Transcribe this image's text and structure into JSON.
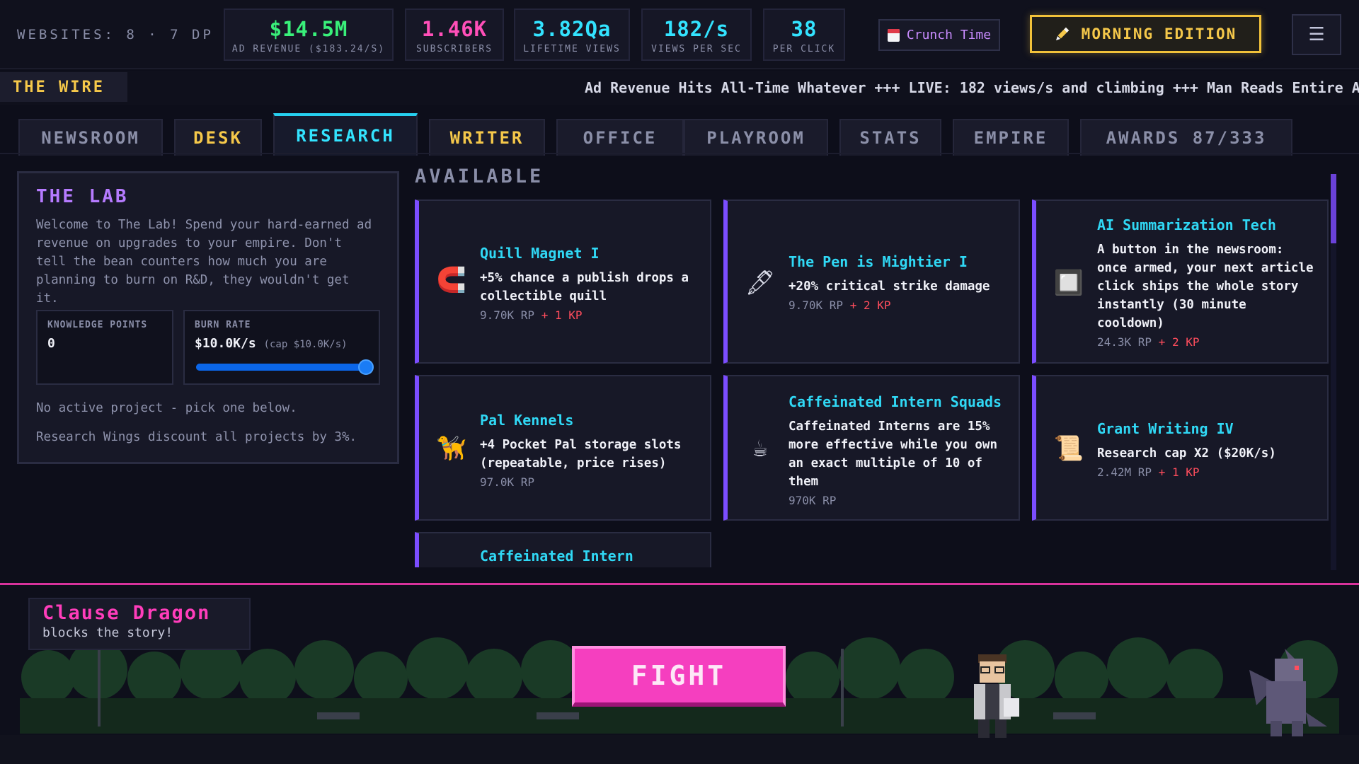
{
  "header": {
    "websites_label": "WEBSITES: 8 · 7 DP",
    "stats": [
      {
        "value": "$14.5M",
        "label": "AD REVENUE ($183.24/S)",
        "color": "#39f07a"
      },
      {
        "value": "1.46K",
        "label": "SUBSCRIBERS",
        "color": "#ff4fb8"
      },
      {
        "value": "3.82Qa",
        "label": "LIFETIME VIEWS",
        "color": "#33e3ff"
      },
      {
        "value": "182/s",
        "label": "VIEWS PER SEC",
        "color": "#33e3ff"
      },
      {
        "value": "38",
        "label": "PER CLICK",
        "color": "#33e3ff"
      }
    ],
    "crunch_label": "Crunch Time",
    "morning_label": "MORNING EDITION",
    "menu_glyph": "☰"
  },
  "wire": {
    "label": "THE WIRE",
    "text": "Ad Revenue Hits All-Time Whatever +++ LIVE: 182 views/s and climbing +++ Man Reads Entire Artic"
  },
  "tabs": [
    {
      "label": "NEWSROOM"
    },
    {
      "label": "DESK"
    },
    {
      "label": "RESEARCH"
    },
    {
      "label": "WRITER"
    },
    {
      "label": "OFFICE"
    },
    {
      "label": "PLAYROOM"
    },
    {
      "label": "STATS"
    },
    {
      "label": "EMPIRE"
    },
    {
      "label": "AWARDS 87/333"
    }
  ],
  "active_tab": "RESEARCH",
  "lab": {
    "title": "THE LAB",
    "description": "Welcome to The Lab! Spend your hard-earned ad revenue on upgrades to your empire. Don't tell the bean counters how much you are planning to burn on R&D, they wouldn't get it.",
    "knowledge_label": "KNOWLEDGE POINTS",
    "knowledge_value": "0",
    "burn_label": "BURN RATE",
    "burn_value": "$10.0K/s",
    "burn_cap": "(cap $10.0K/s)",
    "burn_fraction": 1.0,
    "status": "No active project - pick one below.",
    "discount_note": "Research Wings discount all projects by 3%."
  },
  "available": {
    "title": "AVAILABLE",
    "cards": [
      {
        "icon": "quill-magnet-icon",
        "glyph": "🧲",
        "title": "Quill Magnet I",
        "desc": "+5% chance a publish drops a collectible quill",
        "rp": "9.70K RP",
        "kp": "+ 1 KP"
      },
      {
        "icon": "pen-mightier-icon",
        "glyph": "🖋",
        "title": "The Pen is Mightier I",
        "desc": "+20% critical strike damage",
        "rp": "9.70K RP",
        "kp": "+ 2 KP"
      },
      {
        "icon": "ai-chip-icon",
        "glyph": "🔲",
        "title": "AI Summarization Tech",
        "desc": "A button in the newsroom: once armed, your next article click ships the whole story instantly (30 minute cooldown)",
        "rp": "24.3K RP",
        "kp": "+ 2 KP"
      },
      {
        "icon": "pal-kennel-icon",
        "glyph": "🦮",
        "title": "Pal Kennels",
        "desc": "+4 Pocket Pal storage slots (repeatable, price rises)",
        "rp": "97.0K RP",
        "kp": ""
      },
      {
        "icon": "coffee-cup-icon",
        "glyph": "☕",
        "title": "Caffeinated Intern Squads",
        "desc": "Caffeinated Interns are 15% more effective while you own an exact multiple of 10 of them",
        "rp": "970K RP",
        "kp": ""
      },
      {
        "icon": "grant-scroll-icon",
        "glyph": "📜",
        "title": "Grant Writing IV",
        "desc": "Research cap X2 ($20K/s)",
        "rp": "2.42M RP",
        "kp": "+ 1 KP"
      },
      {
        "icon": "",
        "glyph": "",
        "title": "Caffeinated Intern Mentors",
        "desc": "",
        "rp": "",
        "kp": ""
      }
    ]
  },
  "battle": {
    "enemy_name": "Clause Dragon",
    "enemy_sub": "blocks the story!",
    "fight_label": "FIGHT"
  },
  "colors": {
    "accent_cyan": "#33e3ff",
    "accent_pink": "#ff3dbb",
    "accent_yellow": "#f5c84a",
    "card_border": "#7b4dff",
    "kp_red": "#ff4d5d"
  }
}
